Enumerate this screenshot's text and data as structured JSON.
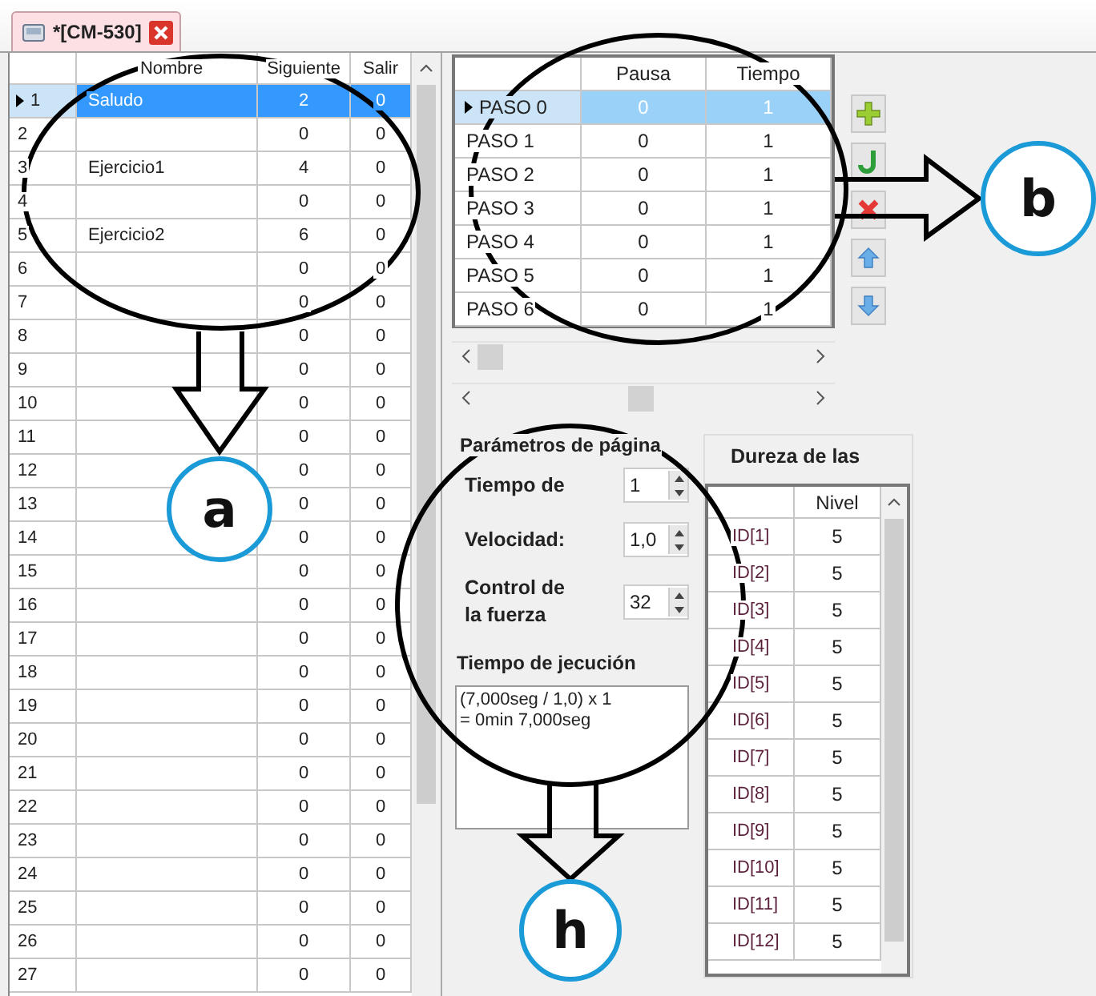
{
  "tab": {
    "title": "*[CM-530]",
    "selected": true
  },
  "pages_table": {
    "columns": [
      "Nombre",
      "Siguiente",
      "Salir"
    ],
    "rows": [
      {
        "number": "1",
        "nombre": "Saludo",
        "siguiente": "2",
        "salir": "0",
        "selected": true
      },
      {
        "number": "2",
        "nombre": "",
        "siguiente": "0",
        "salir": "0",
        "selected": false
      },
      {
        "number": "3",
        "nombre": "Ejercicio1",
        "siguiente": "4",
        "salir": "0",
        "selected": false
      },
      {
        "number": "4",
        "nombre": "",
        "siguiente": "0",
        "salir": "0",
        "selected": false
      },
      {
        "number": "5",
        "nombre": "Ejercicio2",
        "siguiente": "6",
        "salir": "0",
        "selected": false
      },
      {
        "number": "6",
        "nombre": "",
        "siguiente": "0",
        "salir": "0",
        "selected": false
      },
      {
        "number": "7",
        "nombre": "",
        "siguiente": "0",
        "salir": "0",
        "selected": false
      },
      {
        "number": "8",
        "nombre": "",
        "siguiente": "0",
        "salir": "0",
        "selected": false
      },
      {
        "number": "9",
        "nombre": "",
        "siguiente": "0",
        "salir": "0",
        "selected": false
      },
      {
        "number": "10",
        "nombre": "",
        "siguiente": "0",
        "salir": "0",
        "selected": false
      },
      {
        "number": "11",
        "nombre": "",
        "siguiente": "0",
        "salir": "0",
        "selected": false
      },
      {
        "number": "12",
        "nombre": "",
        "siguiente": "0",
        "salir": "0",
        "selected": false
      },
      {
        "number": "13",
        "nombre": "",
        "siguiente": "0",
        "salir": "0",
        "selected": false
      },
      {
        "number": "14",
        "nombre": "",
        "siguiente": "0",
        "salir": "0",
        "selected": false
      },
      {
        "number": "15",
        "nombre": "",
        "siguiente": "0",
        "salir": "0",
        "selected": false
      },
      {
        "number": "16",
        "nombre": "",
        "siguiente": "0",
        "salir": "0",
        "selected": false
      },
      {
        "number": "17",
        "nombre": "",
        "siguiente": "0",
        "salir": "0",
        "selected": false
      },
      {
        "number": "18",
        "nombre": "",
        "siguiente": "0",
        "salir": "0",
        "selected": false
      },
      {
        "number": "19",
        "nombre": "",
        "siguiente": "0",
        "salir": "0",
        "selected": false
      },
      {
        "number": "20",
        "nombre": "",
        "siguiente": "0",
        "salir": "0",
        "selected": false
      },
      {
        "number": "21",
        "nombre": "",
        "siguiente": "0",
        "salir": "0",
        "selected": false
      },
      {
        "number": "22",
        "nombre": "",
        "siguiente": "0",
        "salir": "0",
        "selected": false
      },
      {
        "number": "23",
        "nombre": "",
        "siguiente": "0",
        "salir": "0",
        "selected": false
      },
      {
        "number": "24",
        "nombre": "",
        "siguiente": "0",
        "salir": "0",
        "selected": false
      },
      {
        "number": "25",
        "nombre": "",
        "siguiente": "0",
        "salir": "0",
        "selected": false
      },
      {
        "number": "26",
        "nombre": "",
        "siguiente": "0",
        "salir": "0",
        "selected": false
      },
      {
        "number": "27",
        "nombre": "",
        "siguiente": "0",
        "salir": "0",
        "selected": false
      }
    ]
  },
  "steps_table": {
    "columns": [
      "Pausa",
      "Tiempo"
    ],
    "rows": [
      {
        "name": "PASO 0",
        "pausa": "0",
        "tiempo": "1",
        "selected": true
      },
      {
        "name": "PASO 1",
        "pausa": "0",
        "tiempo": "1",
        "selected": false
      },
      {
        "name": "PASO 2",
        "pausa": "0",
        "tiempo": "1",
        "selected": false
      },
      {
        "name": "PASO 3",
        "pausa": "0",
        "tiempo": "1",
        "selected": false
      },
      {
        "name": "PASO 4",
        "pausa": "0",
        "tiempo": "1",
        "selected": false
      },
      {
        "name": "PASO 5",
        "pausa": "0",
        "tiempo": "1",
        "selected": false
      },
      {
        "name": "PASO 6",
        "pausa": "0",
        "tiempo": "1",
        "selected": false
      }
    ]
  },
  "step_tools": [
    {
      "kind": "add"
    },
    {
      "kind": "hook"
    },
    {
      "kind": "delete"
    },
    {
      "kind": "up"
    },
    {
      "kind": "down"
    }
  ],
  "page_params": {
    "title": "Parámetros de página",
    "fields": [
      {
        "label": "Tiempo de",
        "value": "1"
      },
      {
        "label": "Velocidad:",
        "value": "1,0"
      },
      {
        "label": "Control de la fuerza",
        "value": "32"
      }
    ],
    "exec_title": "Tiempo de jecución",
    "exec_lines": [
      "(7,000seg / 1,0) x 1",
      "= 0min 7,000seg"
    ]
  },
  "hardness": {
    "title": "Dureza de las",
    "column": "Nivel",
    "rows": [
      {
        "id": "ID[1]",
        "nivel": "5"
      },
      {
        "id": "ID[2]",
        "nivel": "5"
      },
      {
        "id": "ID[3]",
        "nivel": "5"
      },
      {
        "id": "ID[4]",
        "nivel": "5"
      },
      {
        "id": "ID[5]",
        "nivel": "5"
      },
      {
        "id": "ID[6]",
        "nivel": "5"
      },
      {
        "id": "ID[7]",
        "nivel": "5"
      },
      {
        "id": "ID[8]",
        "nivel": "5"
      },
      {
        "id": "ID[9]",
        "nivel": "5"
      },
      {
        "id": "ID[10]",
        "nivel": "5"
      },
      {
        "id": "ID[11]",
        "nivel": "5"
      },
      {
        "id": "ID[12]",
        "nivel": "5"
      }
    ]
  },
  "annotations": [
    {
      "label": "a"
    },
    {
      "label": "b"
    },
    {
      "label": "h"
    }
  ]
}
